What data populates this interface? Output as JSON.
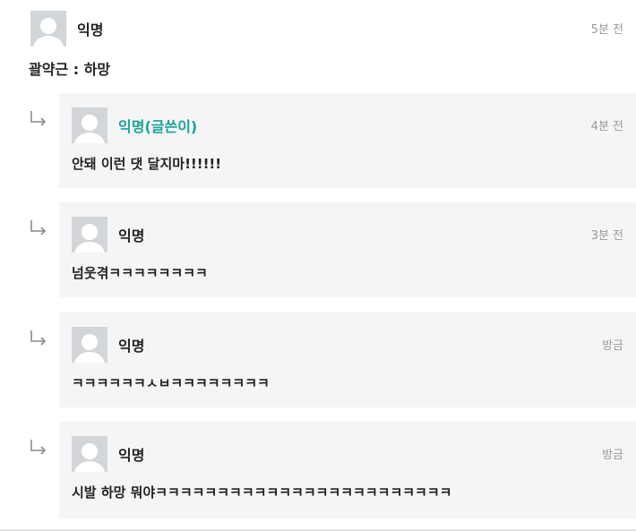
{
  "top_comment": {
    "author": "익명",
    "time": "5분 전",
    "text": "괄약근 : 하망"
  },
  "replies": [
    {
      "author": "익명(글쓴이)",
      "is_author": true,
      "time": "4분 전",
      "text": "안돼 이런 댓 달지마!!!!!!"
    },
    {
      "author": "익명",
      "is_author": false,
      "time": "3분 전",
      "text": "넘웃겪ㅋㅋㅋㅋㅋㅋㅋㅋ"
    },
    {
      "author": "익명",
      "is_author": false,
      "time": "방금",
      "text": "ㅋㅋㅋㅋㅋㅋㅅㅂㅋㅋㅋㅋㅋㅋㅋㅋ"
    },
    {
      "author": "익명",
      "is_author": false,
      "time": "방금",
      "text": "시발 하망 뭐야ㅋㅋㅋㅋㅋㅋㅋㅋㅋㅋㅋㅋㅋㅋㅋㅋㅋㅋㅋㅋㅋㅋㅋㅋ"
    }
  ],
  "colors": {
    "author_accent": "#1aa39a",
    "reply_background": "#f5f5f6",
    "avatar": "#d3d6d8"
  },
  "icons": {
    "reply_arrow": "reply-arrow-icon",
    "avatar": "default-avatar-icon"
  }
}
